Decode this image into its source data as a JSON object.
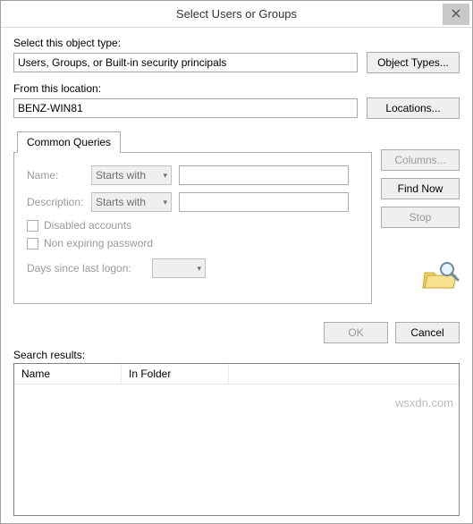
{
  "title": "Select Users or Groups",
  "objectType": {
    "label": "Select this object type:",
    "value": "Users, Groups, or Built-in security principals",
    "button": "Object Types..."
  },
  "location": {
    "label": "From this location:",
    "value": "BENZ-WIN81",
    "button": "Locations..."
  },
  "tab": {
    "label": "Common Queries"
  },
  "queries": {
    "nameLabel": "Name:",
    "nameMode": "Starts with",
    "descLabel": "Description:",
    "descMode": "Starts with",
    "disabledAccounts": "Disabled accounts",
    "nonExpiring": "Non expiring password",
    "daysLogon": "Days since last logon:"
  },
  "buttons": {
    "columns": "Columns...",
    "findNow": "Find Now",
    "stop": "Stop",
    "ok": "OK",
    "cancel": "Cancel"
  },
  "results": {
    "label": "Search results:",
    "cols": {
      "name": "Name",
      "folder": "In Folder"
    }
  },
  "watermark": "wsxdn.com"
}
